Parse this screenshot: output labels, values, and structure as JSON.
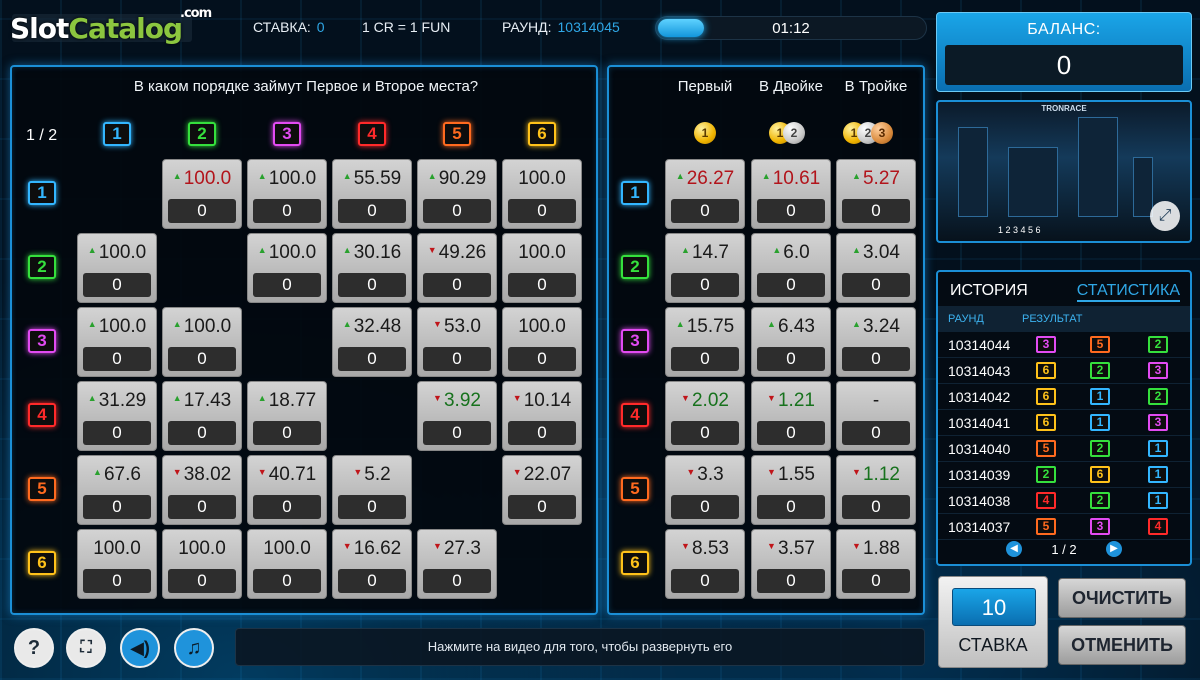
{
  "logo": {
    "slot": "Slot",
    "catalog": "Catalog",
    "com": ".com"
  },
  "topbar": {
    "stake_label": "СТАВКА:",
    "stake_value": "0",
    "rate": "1 CR = 1 FUN",
    "round_label": "РАУНД:",
    "round_value": "10314045",
    "timer": "01:12",
    "timer_progress": 0.17
  },
  "balance": {
    "label": "БАЛАНС:",
    "value": "0"
  },
  "left": {
    "question": "В каком порядке займут Первое и Второе места?",
    "pager": "1 / 2",
    "cols": [
      "1",
      "2",
      "3",
      "4",
      "5",
      "6"
    ],
    "rows": [
      {
        "badge": "1",
        "cells": [
          null,
          {
            "odd": "100.0",
            "dir": "up",
            "tone": "red",
            "stake": "0"
          },
          {
            "odd": "100.0",
            "dir": "up",
            "tone": "",
            "stake": "0"
          },
          {
            "odd": "55.59",
            "dir": "up",
            "tone": "",
            "stake": "0"
          },
          {
            "odd": "90.29",
            "dir": "up",
            "tone": "",
            "stake": "0"
          },
          {
            "odd": "100.0",
            "dir": "",
            "tone": "",
            "stake": "0"
          }
        ]
      },
      {
        "badge": "2",
        "cells": [
          {
            "odd": "100.0",
            "dir": "up",
            "tone": "",
            "stake": "0"
          },
          null,
          {
            "odd": "100.0",
            "dir": "up",
            "tone": "",
            "stake": "0"
          },
          {
            "odd": "30.16",
            "dir": "up",
            "tone": "",
            "stake": "0"
          },
          {
            "odd": "49.26",
            "dir": "down",
            "tone": "",
            "stake": "0"
          },
          {
            "odd": "100.0",
            "dir": "",
            "tone": "",
            "stake": "0"
          }
        ]
      },
      {
        "badge": "3",
        "cells": [
          {
            "odd": "100.0",
            "dir": "up",
            "tone": "",
            "stake": "0"
          },
          {
            "odd": "100.0",
            "dir": "up",
            "tone": "",
            "stake": "0"
          },
          null,
          {
            "odd": "32.48",
            "dir": "up",
            "tone": "",
            "stake": "0"
          },
          {
            "odd": "53.0",
            "dir": "down",
            "tone": "",
            "stake": "0"
          },
          {
            "odd": "100.0",
            "dir": "",
            "tone": "",
            "stake": "0"
          }
        ]
      },
      {
        "badge": "4",
        "cells": [
          {
            "odd": "31.29",
            "dir": "up",
            "tone": "",
            "stake": "0"
          },
          {
            "odd": "17.43",
            "dir": "up",
            "tone": "",
            "stake": "0"
          },
          {
            "odd": "18.77",
            "dir": "up",
            "tone": "",
            "stake": "0"
          },
          null,
          {
            "odd": "3.92",
            "dir": "down",
            "tone": "green",
            "stake": "0"
          },
          {
            "odd": "10.14",
            "dir": "down",
            "tone": "",
            "stake": "0"
          }
        ]
      },
      {
        "badge": "5",
        "cells": [
          {
            "odd": "67.6",
            "dir": "up",
            "tone": "",
            "stake": "0"
          },
          {
            "odd": "38.02",
            "dir": "down",
            "tone": "",
            "stake": "0"
          },
          {
            "odd": "40.71",
            "dir": "down",
            "tone": "",
            "stake": "0"
          },
          {
            "odd": "5.2",
            "dir": "down",
            "tone": "",
            "stake": "0"
          },
          null,
          {
            "odd": "22.07",
            "dir": "down",
            "tone": "",
            "stake": "0"
          }
        ]
      },
      {
        "badge": "6",
        "cells": [
          {
            "odd": "100.0",
            "dir": "",
            "tone": "",
            "stake": "0"
          },
          {
            "odd": "100.0",
            "dir": "",
            "tone": "",
            "stake": "0"
          },
          {
            "odd": "100.0",
            "dir": "",
            "tone": "",
            "stake": "0"
          },
          {
            "odd": "16.62",
            "dir": "down",
            "tone": "",
            "stake": "0"
          },
          {
            "odd": "27.3",
            "dir": "down",
            "tone": "",
            "stake": "0"
          },
          null
        ]
      }
    ]
  },
  "right": {
    "headers": [
      "Первый",
      "В Двойке",
      "В Тройке"
    ],
    "rows": [
      {
        "badge": "1",
        "cells": [
          {
            "odd": "26.27",
            "dir": "up",
            "tone": "red",
            "stake": "0"
          },
          {
            "odd": "10.61",
            "dir": "up",
            "tone": "red",
            "stake": "0"
          },
          {
            "odd": "5.27",
            "dir": "up",
            "tone": "red",
            "stake": "0"
          }
        ]
      },
      {
        "badge": "2",
        "cells": [
          {
            "odd": "14.7",
            "dir": "up",
            "tone": "",
            "stake": "0"
          },
          {
            "odd": "6.0",
            "dir": "up",
            "tone": "",
            "stake": "0"
          },
          {
            "odd": "3.04",
            "dir": "up",
            "tone": "",
            "stake": "0"
          }
        ]
      },
      {
        "badge": "3",
        "cells": [
          {
            "odd": "15.75",
            "dir": "up",
            "tone": "",
            "stake": "0"
          },
          {
            "odd": "6.43",
            "dir": "up",
            "tone": "",
            "stake": "0"
          },
          {
            "odd": "3.24",
            "dir": "up",
            "tone": "",
            "stake": "0"
          }
        ]
      },
      {
        "badge": "4",
        "cells": [
          {
            "odd": "2.02",
            "dir": "down",
            "tone": "green",
            "stake": "0"
          },
          {
            "odd": "1.21",
            "dir": "down",
            "tone": "green",
            "stake": "0"
          },
          {
            "odd": "-",
            "dir": "",
            "tone": "",
            "stake": "0"
          }
        ]
      },
      {
        "badge": "5",
        "cells": [
          {
            "odd": "3.3",
            "dir": "down",
            "tone": "",
            "stake": "0"
          },
          {
            "odd": "1.55",
            "dir": "down",
            "tone": "",
            "stake": "0"
          },
          {
            "odd": "1.12",
            "dir": "down",
            "tone": "green",
            "stake": "0"
          }
        ]
      },
      {
        "badge": "6",
        "cells": [
          {
            "odd": "8.53",
            "dir": "down",
            "tone": "",
            "stake": "0"
          },
          {
            "odd": "3.57",
            "dir": "down",
            "tone": "",
            "stake": "0"
          },
          {
            "odd": "1.88",
            "dir": "down",
            "tone": "",
            "stake": "0"
          }
        ]
      }
    ]
  },
  "colors": {
    "1": "#33b6ff",
    "2": "#35e03d",
    "3": "#e24bf2",
    "4": "#ff2a2a",
    "5": "#ff6a1f",
    "6": "#ffc21a"
  },
  "video": {
    "title": "TRONRACE",
    "strip": "1 2 3 4 5 6"
  },
  "history": {
    "tab_history": "ИСТОРИЯ",
    "tab_stats": "СТАТИСТИКА",
    "col_round": "РАУНД",
    "col_result": "РЕЗУЛЬТАТ",
    "rows": [
      {
        "round": "10314044",
        "res": [
          "3",
          "5",
          "2"
        ]
      },
      {
        "round": "10314043",
        "res": [
          "6",
          "2",
          "3"
        ]
      },
      {
        "round": "10314042",
        "res": [
          "6",
          "1",
          "2"
        ]
      },
      {
        "round": "10314041",
        "res": [
          "6",
          "1",
          "3"
        ]
      },
      {
        "round": "10314040",
        "res": [
          "5",
          "2",
          "1"
        ]
      },
      {
        "round": "10314039",
        "res": [
          "2",
          "6",
          "1"
        ]
      },
      {
        "round": "10314038",
        "res": [
          "4",
          "2",
          "1"
        ]
      },
      {
        "round": "10314037",
        "res": [
          "5",
          "3",
          "4"
        ]
      }
    ],
    "pager": "1 / 2"
  },
  "bet": {
    "amount": "10",
    "label": "СТАВКА",
    "clear": "ОЧИСТИТЬ",
    "cancel": "ОТМЕНИТЬ"
  },
  "bottom": {
    "help": "?",
    "hint": "Нажмите на видео для того, чтобы развернуть его"
  }
}
